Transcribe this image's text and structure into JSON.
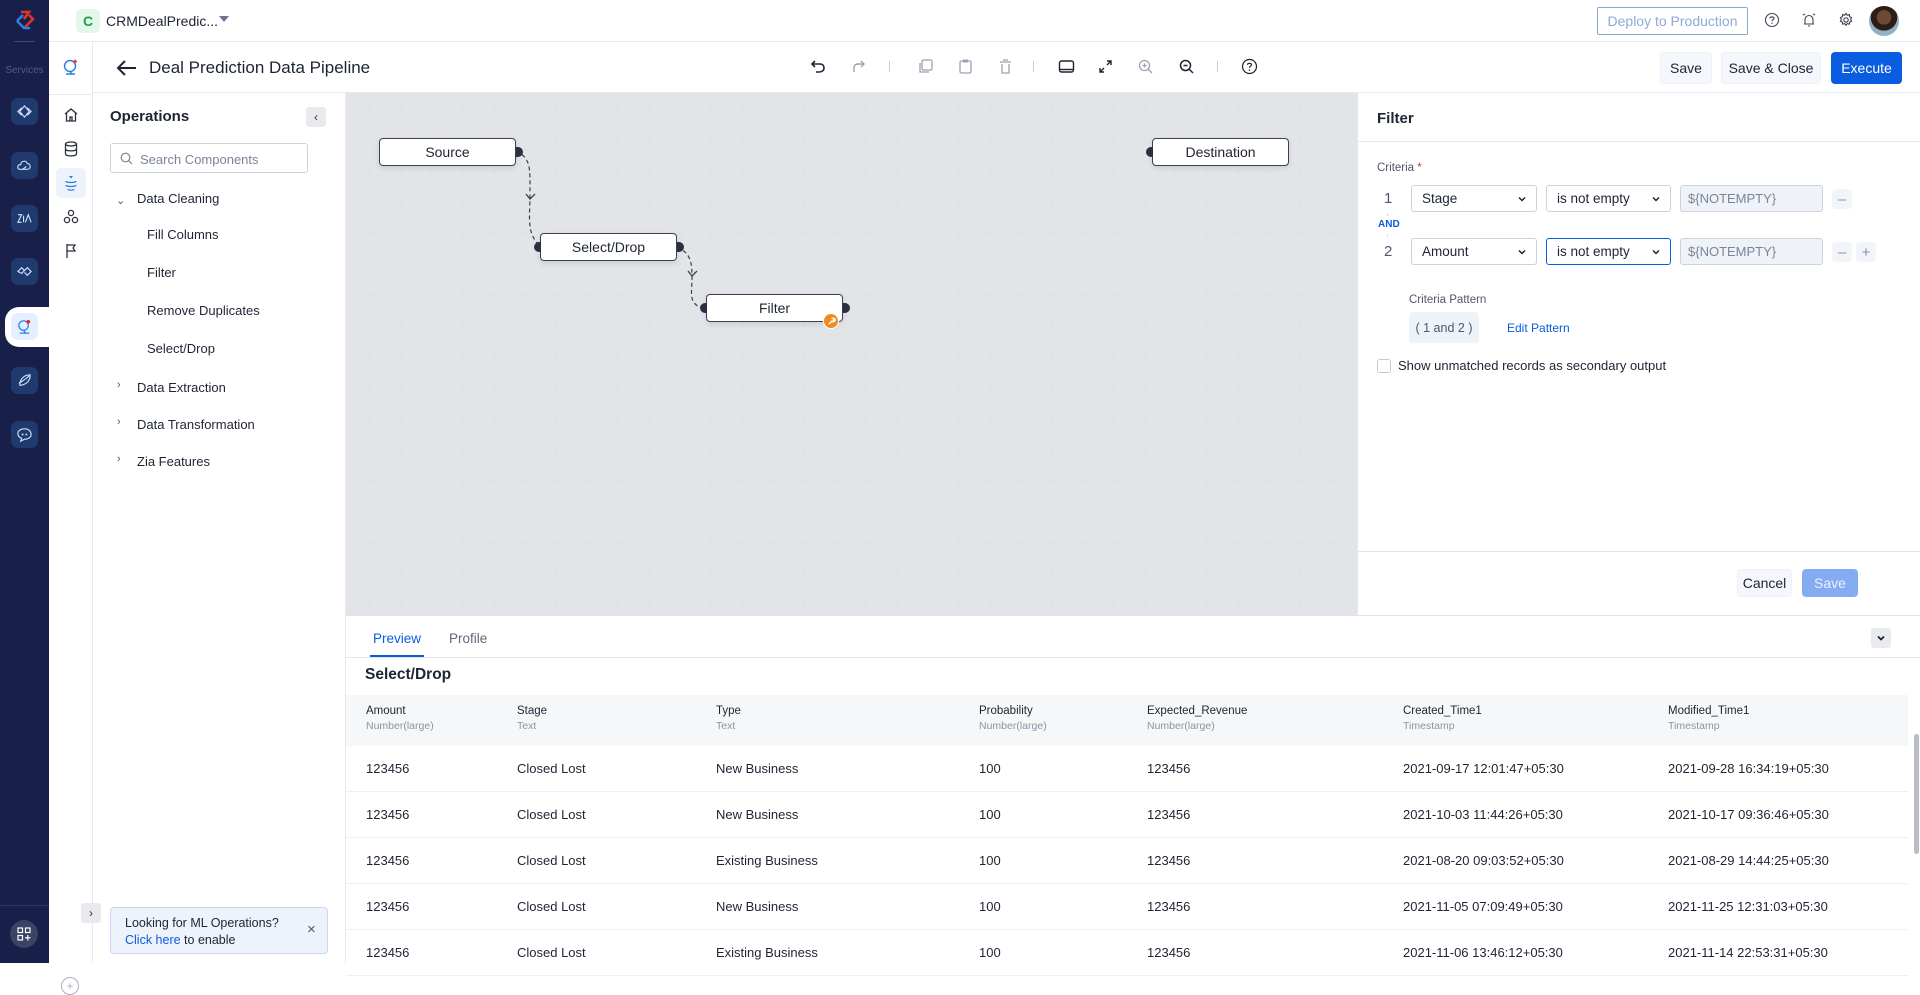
{
  "rail": {
    "services_label": "Services",
    "service_icons": [
      "code-icon",
      "cloud-icon",
      "zia-icon",
      "integration-icon",
      "ml-icon",
      "rocket-icon",
      "chatbot-icon"
    ],
    "active_service": "ml-icon",
    "apps_icon": "apps-add-icon"
  },
  "topbar": {
    "project_initial": "C",
    "project_name": "CRMDealPredic...",
    "deploy_label": "Deploy to Production",
    "icons": [
      "help-icon",
      "notification-icon",
      "settings-icon",
      "avatar"
    ]
  },
  "icon_column": {
    "items": [
      "ml-logo-icon",
      "home-icon",
      "database-icon",
      "pipeline-icon",
      "models-icon",
      "flag-icon"
    ],
    "active": "pipeline-icon"
  },
  "header": {
    "title": "Deal Prediction Data Pipeline",
    "toolbar": [
      "undo-icon",
      "redo-icon",
      "copy-icon",
      "paste-icon",
      "delete-icon",
      "panel-icon",
      "fit-screen-icon",
      "zoom-in-icon",
      "zoom-out-icon",
      "help-icon"
    ],
    "save_label": "Save",
    "save_close_label": "Save & Close",
    "execute_label": "Execute",
    "colors": {
      "primary": "#0a5ce0"
    }
  },
  "operations": {
    "title": "Operations",
    "search_placeholder": "Search Components",
    "groups": [
      {
        "label": "Data Cleaning",
        "expanded": true,
        "items": [
          "Fill Columns",
          "Filter",
          "Remove Duplicates",
          "Select/Drop"
        ]
      },
      {
        "label": "Data Extraction",
        "expanded": false
      },
      {
        "label": "Data Transformation",
        "expanded": false
      },
      {
        "label": "Zia Features",
        "expanded": false
      }
    ],
    "banner": {
      "line1": "Looking for ML Operations?",
      "link": "Click here",
      "line2_rest": " to enable"
    }
  },
  "canvas": {
    "nodes": [
      {
        "label": "Source"
      },
      {
        "label": "Select/Drop"
      },
      {
        "label": "Filter",
        "badge": "wrench-icon"
      },
      {
        "label": "Destination"
      }
    ]
  },
  "filter_panel": {
    "title": "Filter",
    "criteria_label": "Criteria",
    "required_mark": "*",
    "criteria": [
      {
        "num": "1",
        "field": "Stage",
        "operator": "is not empty",
        "value": "${NOTEMPTY}"
      },
      {
        "num": "2",
        "field": "Amount",
        "operator": "is not empty",
        "value": "${NOTEMPTY}"
      }
    ],
    "connector": "AND",
    "pattern_label": "Criteria Pattern",
    "pattern": "( 1 and 2 )",
    "edit_pattern": "Edit Pattern",
    "checkbox_label": "Show unmatched records as secondary output",
    "checkbox_checked": false,
    "cancel_label": "Cancel",
    "save_label": "Save"
  },
  "preview": {
    "tabs": [
      "Preview",
      "Profile"
    ],
    "active_tab": "Preview",
    "section_title": "Select/Drop",
    "columns": [
      {
        "name": "Amount",
        "type": "Number(large)"
      },
      {
        "name": "Stage",
        "type": "Text"
      },
      {
        "name": "Type",
        "type": "Text"
      },
      {
        "name": "Probability",
        "type": "Number(large)"
      },
      {
        "name": "Expected_Revenue",
        "type": "Number(large)"
      },
      {
        "name": "Created_Time1",
        "type": "Timestamp"
      },
      {
        "name": "Modified_Time1",
        "type": "Timestamp"
      }
    ],
    "rows": [
      [
        "123456",
        "Closed Lost",
        "New Business",
        "100",
        "123456",
        "2021-09-17 12:01:47+05:30",
        "2021-09-28 16:34:19+05:30"
      ],
      [
        "123456",
        "Closed Lost",
        "New Business",
        "100",
        "123456",
        "2021-10-03 11:44:26+05:30",
        "2021-10-17 09:36:46+05:30"
      ],
      [
        "123456",
        "Closed Lost",
        "Existing Business",
        "100",
        "123456",
        "2021-08-20 09:03:52+05:30",
        "2021-08-29 14:44:25+05:30"
      ],
      [
        "123456",
        "Closed Lost",
        "New Business",
        "100",
        "123456",
        "2021-11-05 07:09:49+05:30",
        "2021-11-25 12:31:03+05:30"
      ],
      [
        "123456",
        "Closed Lost",
        "Existing Business",
        "100",
        "123456",
        "2021-11-06 13:46:12+05:30",
        "2021-11-14 22:53:31+05:30"
      ]
    ]
  }
}
